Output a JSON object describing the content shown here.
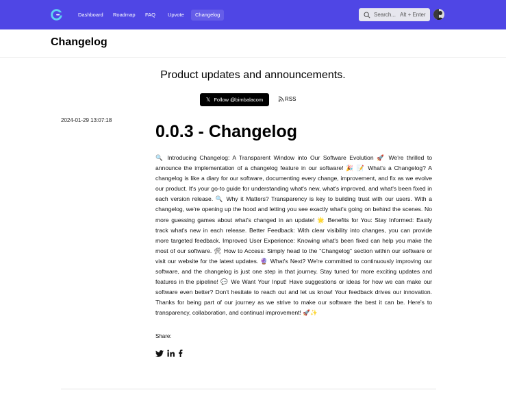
{
  "nav": {
    "links": [
      "Dashboard",
      "Roadmap",
      "FAQ",
      "Upvote",
      "Changelog"
    ],
    "active": "Changelog",
    "search_placeholder": "Search...",
    "search_shortcut": "Alt + Enter"
  },
  "header": {
    "title": "Changelog"
  },
  "hero": {
    "tagline": "Product updates and announcements.",
    "follow_label": "Follow @bimbalacom",
    "rss_label": "RSS"
  },
  "post": {
    "date": "2024-01-29 13:07:18",
    "title": "0.0.3 - Changelog",
    "body": "🔍 Introducing Changelog: A Transparent Window into Our Software Evolution 🚀 We're thrilled to announce the implementation of a changelog feature in our software! 🎉 📝 What's a Changelog? A changelog is like a diary for our software, documenting every change, improvement, and fix as we evolve our product. It's your go-to guide for understanding what's new, what's improved, and what's been fixed in each version release. 🔍 Why it Matters? Transparency is key to building trust with our users. With a changelog, we're opening up the hood and letting you see exactly what's going on behind the scenes. No more guessing games about what's changed in an update! 🌟 Benefits for You: Stay Informed: Easily track what's new in each release. Better Feedback: With clear visibility into changes, you can provide more targeted feedback. Improved User Experience: Knowing what's been fixed can help you make the most of our software. 🛠 How to Access: Simply head to the \"Changelog\" section within our software or visit our website for the latest updates. 🔮 What's Next? We're committed to continuously improving our software, and the changelog is just one step in that journey. Stay tuned for more exciting updates and features in the pipeline! 💬 We Want Your Input! Have suggestions or ideas for how we can make our software even better? Don't hesitate to reach out and let us know! Your feedback drives our innovation. Thanks for being part of our journey as we strive to make our software the best it can be. Here's to transparency, collaboration, and continual improvement! 🚀✨"
  },
  "share": {
    "label": "Share:",
    "icons": [
      "twitter-icon",
      "linkedin-icon",
      "facebook-icon"
    ]
  },
  "colors": {
    "nav_bg": "#4f46e5",
    "button_bg": "#000000"
  }
}
